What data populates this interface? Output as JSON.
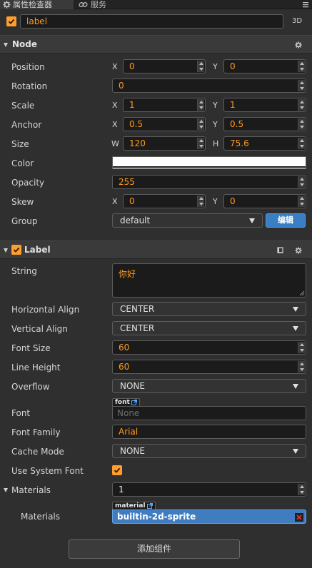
{
  "tabs": {
    "inspector": "属性检查器",
    "service": "服务"
  },
  "node_header": {
    "name_value": "label",
    "mode_3d": "3D"
  },
  "node_section": {
    "title": "Node",
    "position": {
      "label": "Position",
      "x_axis": "X",
      "y_axis": "Y",
      "x": "0",
      "y": "0"
    },
    "rotation": {
      "label": "Rotation",
      "value": "0"
    },
    "scale": {
      "label": "Scale",
      "x_axis": "X",
      "y_axis": "Y",
      "x": "1",
      "y": "1"
    },
    "anchor": {
      "label": "Anchor",
      "x_axis": "X",
      "y_axis": "Y",
      "x": "0.5",
      "y": "0.5"
    },
    "size": {
      "label": "Size",
      "w_axis": "W",
      "h_axis": "H",
      "w": "120",
      "h": "75.6"
    },
    "color": {
      "label": "Color",
      "value": "#ffffff"
    },
    "opacity": {
      "label": "Opacity",
      "value": "255"
    },
    "skew": {
      "label": "Skew",
      "x_axis": "X",
      "y_axis": "Y",
      "x": "0",
      "y": "0"
    },
    "group": {
      "label": "Group",
      "value": "default",
      "edit_button": "编辑"
    }
  },
  "label_section": {
    "title": "Label",
    "string": {
      "label": "String",
      "value": "你好"
    },
    "horizontal_align": {
      "label": "Horizontal Align",
      "value": "CENTER"
    },
    "vertical_align": {
      "label": "Vertical Align",
      "value": "CENTER"
    },
    "font_size": {
      "label": "Font Size",
      "value": "60"
    },
    "line_height": {
      "label": "Line Height",
      "value": "60"
    },
    "overflow": {
      "label": "Overflow",
      "value": "NONE"
    },
    "font": {
      "label": "Font",
      "tag": "font",
      "value": "None"
    },
    "font_family": {
      "label": "Font Family",
      "value": "Arial"
    },
    "cache_mode": {
      "label": "Cache Mode",
      "value": "NONE"
    },
    "use_system_font": {
      "label": "Use System Font",
      "checked": true
    },
    "materials_group": {
      "label": "Materials",
      "count": "1"
    },
    "materials": {
      "label": "Materials",
      "tag": "material",
      "value": "builtin-2d-sprite"
    }
  },
  "add_component_button": "添加组件",
  "colors": {
    "accent_orange": "#ff9a1f",
    "check_orange": "#ff9e2c",
    "button_blue": "#3a7fc4",
    "panel_bg": "#2f2f2f"
  }
}
